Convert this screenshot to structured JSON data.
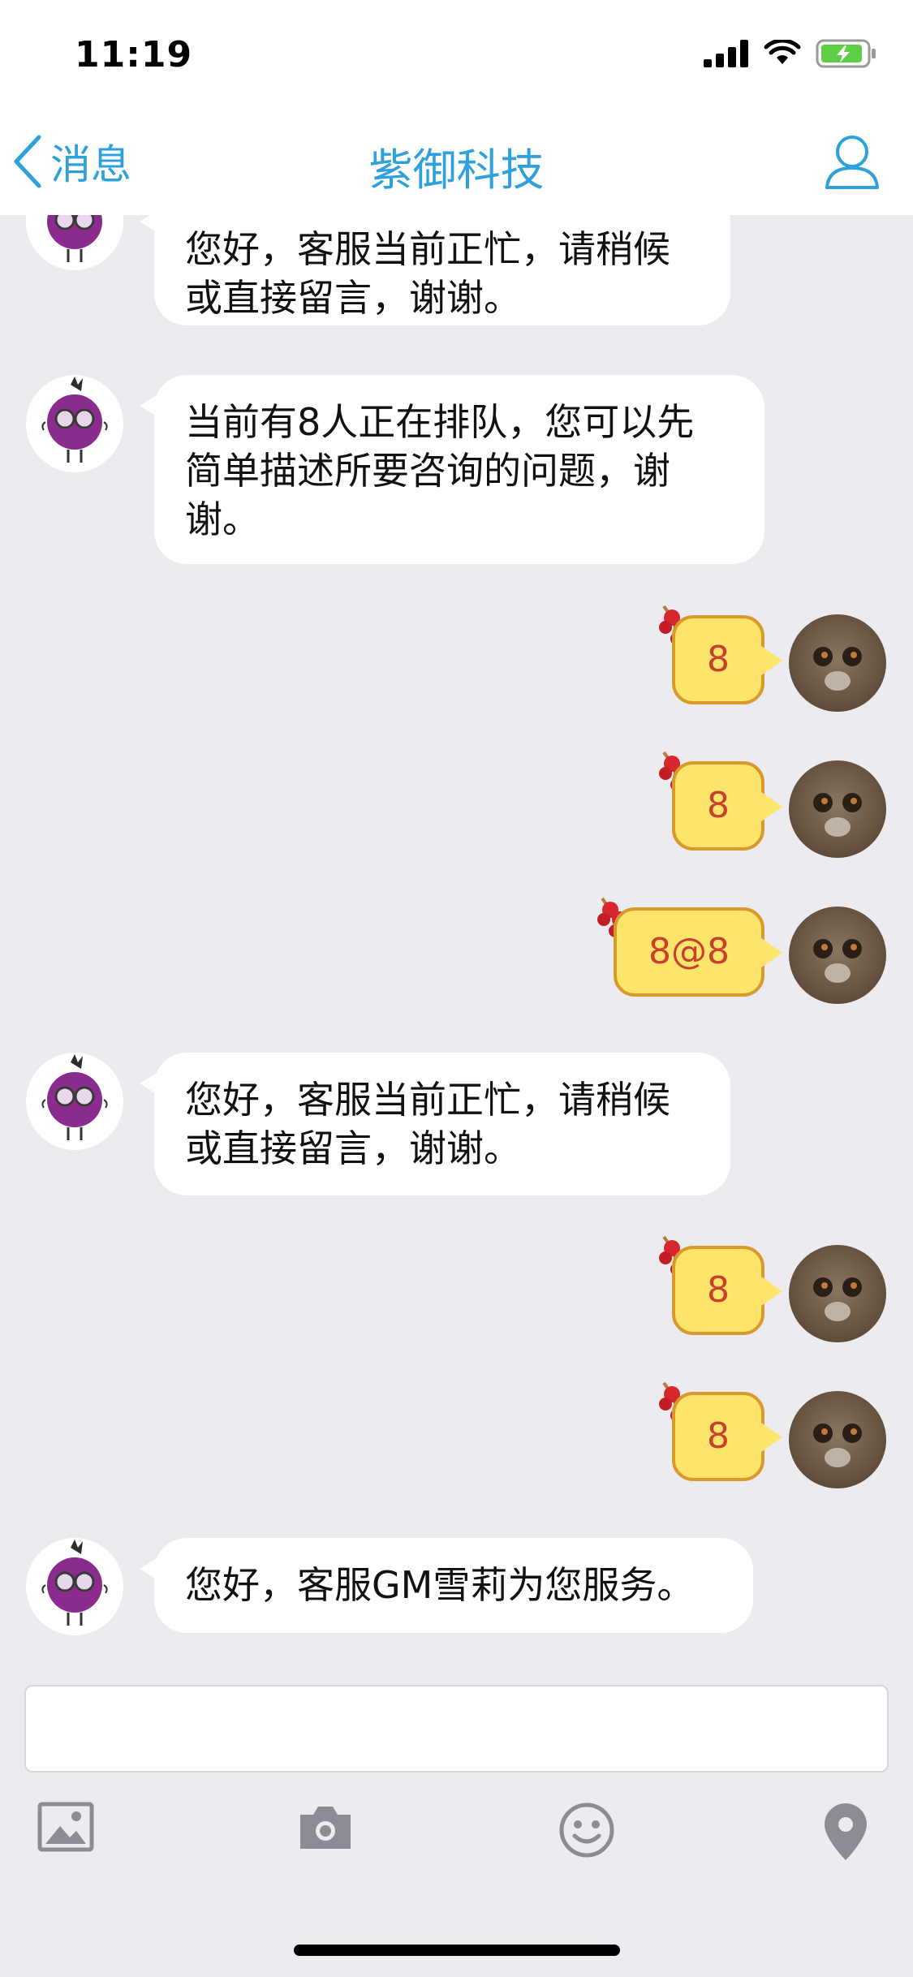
{
  "status_bar": {
    "time": "11:19"
  },
  "nav": {
    "back_label": "消息",
    "title": "紫御科技"
  },
  "messages": [
    {
      "side": "in",
      "lines": [
        "您好，客服当前正忙，请稍候",
        "或直接留言，谢谢。"
      ]
    },
    {
      "side": "in",
      "lines": [
        "当前有8人正在排队，您可以先",
        "简单描述所要咨询的问题，谢",
        "谢。"
      ]
    },
    {
      "side": "out",
      "text": "8"
    },
    {
      "side": "out",
      "text": "8"
    },
    {
      "side": "out",
      "text": "8@8"
    },
    {
      "side": "in",
      "lines": [
        "您好，客服当前正忙，请稍候",
        "或直接留言，谢谢。"
      ]
    },
    {
      "side": "out",
      "text": "8"
    },
    {
      "side": "out",
      "text": "8"
    },
    {
      "side": "in",
      "lines": [
        "您好，客服GM雪莉为您服务。"
      ]
    }
  ],
  "input": {
    "placeholder": ""
  },
  "toolbar": {
    "icons": [
      "image-icon",
      "camera-icon",
      "emoji-icon",
      "location-icon"
    ]
  },
  "colors": {
    "accent": "#2ea0db",
    "background": "#ebebf0",
    "candy_bubble": "#fde46a",
    "candy_text": "#c8402e"
  }
}
